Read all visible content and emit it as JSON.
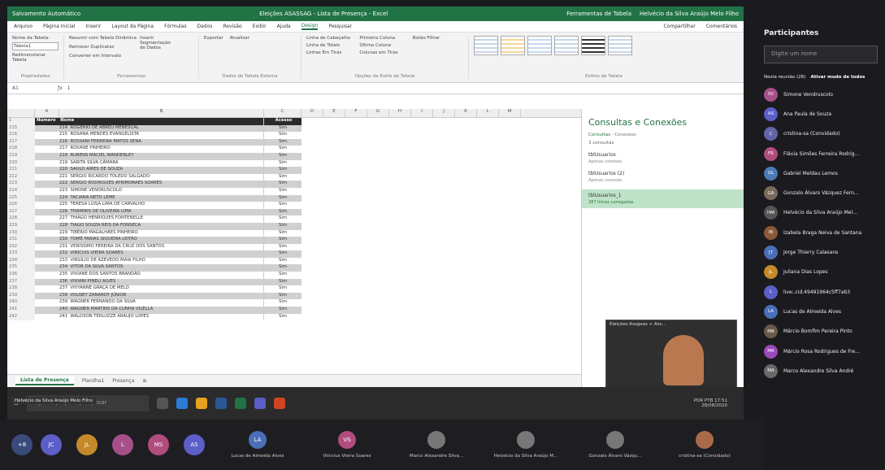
{
  "excel": {
    "autosave": "Salvamento Automático",
    "title": "Eleições ASASSAG - Lista de Presença - Excel",
    "table_tools": "Ferramentas de Tabela",
    "user": "Helvécio da Silva Araújo Melo Filho",
    "tabs": [
      "Arquivo",
      "Página Inicial",
      "Inserir",
      "Layout da Página",
      "Fórmulas",
      "Dados",
      "Revisão",
      "Exibir",
      "Ajuda",
      "Design",
      "Pesquisar"
    ],
    "share": "Compartilhar",
    "comments": "Comentários",
    "groups": {
      "props": "Propriedades",
      "tools": "Ferramentas",
      "external": "Dados de Tabela Externa",
      "options": "Opções de Estilo de Tabela",
      "styles": "Estilos de Tabela"
    },
    "ribbon_items": {
      "table_name": "Nome da Tabela:",
      "table_val": "Tabela1",
      "resize": "Redimensionar Tabela",
      "summarize": "Resumir com Tabela Dinâmica",
      "remove_dup": "Remover Duplicatas",
      "convert": "Converter em Intervalo",
      "slicer": "Inserir Segmentação de Dados",
      "export": "Exportar",
      "refresh": "Atualizar",
      "header_row": "Linha de Cabeçalho",
      "total_row": "Linha de Totais",
      "banded_rows": "Linhas Em Tiras",
      "first_col": "Primeira Coluna",
      "last_col": "Última Coluna",
      "banded_cols": "Colunas em Tiras",
      "filter_btn": "Botão Filtrar"
    },
    "cellref": "A1",
    "formula": "1",
    "col_letters": [
      "A",
      "B",
      "C",
      "D",
      "E",
      "F",
      "G",
      "H",
      "I",
      "J",
      "K",
      "L",
      "M"
    ],
    "hdr": {
      "rn": "1",
      "num": "Número",
      "name": "Nome",
      "access": "Acesso"
    },
    "rows": [
      {
        "rn": "215",
        "num": "214",
        "name": "ROGÉRIO DE ABREU MENESCAL",
        "a": "Sim"
      },
      {
        "rn": "216",
        "num": "215",
        "name": "ROSANA MENDES EVANGELISTA",
        "a": "Sim"
      },
      {
        "rn": "217",
        "num": "216",
        "name": "ROSSANI FERREIRA MATOS SENA",
        "a": "Sim"
      },
      {
        "rn": "218",
        "num": "217",
        "name": "ROXANE PINHEIRO",
        "a": "Sim"
      },
      {
        "rn": "219",
        "num": "218",
        "name": "RUBENS MACIEL WANDERLEY",
        "a": "Sim"
      },
      {
        "rn": "220",
        "num": "219",
        "name": "SARITA SILVA CÂMARA",
        "a": "Sim"
      },
      {
        "rn": "221",
        "num": "220",
        "name": "SAULO AIRES DE SOUZA",
        "a": "Sim"
      },
      {
        "rn": "222",
        "num": "221",
        "name": "SERGIO RICARDO TOLEDO SALGADO",
        "a": "Sim"
      },
      {
        "rn": "223",
        "num": "222",
        "name": "SERGIO RODRIGUES AYRIMORAES SOARES",
        "a": "Sim"
      },
      {
        "rn": "224",
        "num": "223",
        "name": "SIMONE VENDRUSCOLO",
        "a": "Sim"
      },
      {
        "rn": "225",
        "num": "224",
        "name": "TACIANA NETO LEME",
        "a": "Sim"
      },
      {
        "rn": "226",
        "num": "225",
        "name": "TERESA LUISA LIMA DE CARVALHO",
        "a": "Sim"
      },
      {
        "rn": "227",
        "num": "226",
        "name": "THAMIRIS DE OLIVEIRA LIMA",
        "a": "Sim"
      },
      {
        "rn": "228",
        "num": "227",
        "name": "THIAGO HENRIQUES FONTENELLE",
        "a": "Sim"
      },
      {
        "rn": "229",
        "num": "228",
        "name": "TIAGO SOUZA REIS DA FONSECA",
        "a": "Sim"
      },
      {
        "rn": "230",
        "num": "229",
        "name": "TIBÉRIO MAGALHÃES PINHEIRO",
        "a": "Sim"
      },
      {
        "rn": "231",
        "num": "230",
        "name": "TOMÉ FARIAS SIQUEIRA LEITÃO",
        "a": "Sim"
      },
      {
        "rn": "232",
        "num": "231",
        "name": "VERISSIMO PEREIRA DA CRUZ DOS SANTOS",
        "a": "Sim"
      },
      {
        "rn": "233",
        "num": "232",
        "name": "VINÍCIUS VIEIRA SOARES",
        "a": "Sim"
      },
      {
        "rn": "234",
        "num": "233",
        "name": "VIRGÍLIO DE AZEVEDO MAIA FILHO",
        "a": "Sim"
      },
      {
        "rn": "235",
        "num": "234",
        "name": "VITOR DA SILVA SANTOS",
        "a": "Sim"
      },
      {
        "rn": "236",
        "num": "235",
        "name": "VIVIANE DOS SANTOS BRANDÃO",
        "a": "Sim"
      },
      {
        "rn": "237",
        "num": "236",
        "name": "VIVIANI PINELI ALVES",
        "a": "Sim"
      },
      {
        "rn": "238",
        "num": "237",
        "name": "VIVYANNE GRAÇA DE MELO",
        "a": "Sim"
      },
      {
        "rn": "239",
        "num": "238",
        "name": "VOLNEY ZANARDY JÚNIOR",
        "a": "Sim"
      },
      {
        "rn": "240",
        "num": "239",
        "name": "WAGNER FERNANDO DA SILVA",
        "a": "Sim"
      },
      {
        "rn": "241",
        "num": "240",
        "name": "WAGNER MARTINS DA CUNHA VILELLA",
        "a": "Sim"
      },
      {
        "rn": "242",
        "num": "241",
        "name": "WALDSON TERLUZZE ARAUJO LOPES",
        "a": "Sim"
      }
    ],
    "sheets": [
      "Lista de Presença",
      "Planilha1",
      "Presença"
    ],
    "panel": {
      "title": "Consultas e Conexões",
      "tab1": "Consultas",
      "tab2": "Conexões",
      "count": "3 consultas",
      "queries": [
        {
          "name": "tblUsuarios",
          "desc": "Apenas conexão."
        },
        {
          "name": "tblUsuarios (2)",
          "desc": "Apenas conexão."
        },
        {
          "name": "tblUsuarios_1",
          "desc": "287 linhas carregadas."
        }
      ]
    },
    "video_title": "Eleições Assgeas + Ass... ",
    "taskbar": {
      "search": "Digite aqui para pesquisar",
      "lang": "POR PTB",
      "time": "17:51",
      "date": "28/08/2020"
    },
    "presenter": "Helvécio da Silva Araújo Melo Filho"
  },
  "teams": {
    "title": "Participantes",
    "search": "Digite um nome",
    "section": "Nesta reunião (26)",
    "mute_all": "Ativar mudo de todos",
    "participants": [
      {
        "i": "SV",
        "n": "Simone Vendruscolo",
        "c": "#a64f8a"
      },
      {
        "i": "AS",
        "n": "Ana Paula de Souza",
        "c": "#5b5fc7"
      },
      {
        "i": "C",
        "n": "cristina-sa (Convidado)",
        "c": "#6264a7"
      },
      {
        "i": "FR",
        "n": "Flávia Simões Ferreira Rodrig...",
        "c": "#b14d7d"
      },
      {
        "i": "GL",
        "n": "Gabriel Meldau Lemos",
        "c": "#4a7ab8"
      },
      {
        "i": "GÁ",
        "n": "Gonzalo Álvaro Vázquez Fern...",
        "c": "#7a6a5a"
      },
      {
        "i": "HM",
        "n": "Helvécio da Silva Araújo Mel...",
        "c": "#555"
      },
      {
        "i": "IB",
        "n": "Izabela Braga Neiva de Santana",
        "c": "#8a5a3a"
      },
      {
        "i": "JT",
        "n": "Jorge Thierry Calasans",
        "c": "#4a6fb8"
      },
      {
        "i": "JL",
        "n": "Juliana Dias Lopes",
        "c": "#c48a2a"
      },
      {
        "i": "L",
        "n": "live:.cid.49491964c5ff7ab3",
        "c": "#5b5fc7"
      },
      {
        "i": "LA",
        "n": "Lucas de Almeida Alves",
        "c": "#4a6fb8"
      },
      {
        "i": "MB",
        "n": "Márcio Bomfim Pereira Pinto",
        "c": "#6a5a4a"
      },
      {
        "i": "MR",
        "n": "Márcio Rosa Rodrigues de Fre...",
        "c": "#9a4ab8"
      },
      {
        "i": "MA",
        "n": "Marco Alexandre Silva André",
        "c": "#6a6a6a"
      }
    ],
    "bottom_count": "+8",
    "bottom_avatars": [
      {
        "i": "JC",
        "c": "#5b5fc7"
      },
      {
        "i": "JL",
        "c": "#c48a2a"
      },
      {
        "i": "L",
        "c": "#a64f8a"
      },
      {
        "i": "MS",
        "c": "#b14d7d"
      },
      {
        "i": "AS",
        "c": "#5b5fc7"
      }
    ],
    "tiles": [
      {
        "i": "LA",
        "n": "Lucas de Almeida Alves",
        "c": "#4a6fb8"
      },
      {
        "i": "VS",
        "n": "Vinicius Vieira Soares",
        "c": "#b14d7d"
      },
      {
        "i": "",
        "n": "Marco Alexandre Silva...",
        "c": "#777"
      },
      {
        "i": "",
        "n": "Helvécio da Silva Araújo M...",
        "c": "#777"
      },
      {
        "i": "",
        "n": "Gonzalo Álvaro Vázqu...",
        "c": "#777"
      },
      {
        "i": "",
        "n": "cristina-sa (Convidado)",
        "c": "#a86a4a"
      }
    ]
  }
}
